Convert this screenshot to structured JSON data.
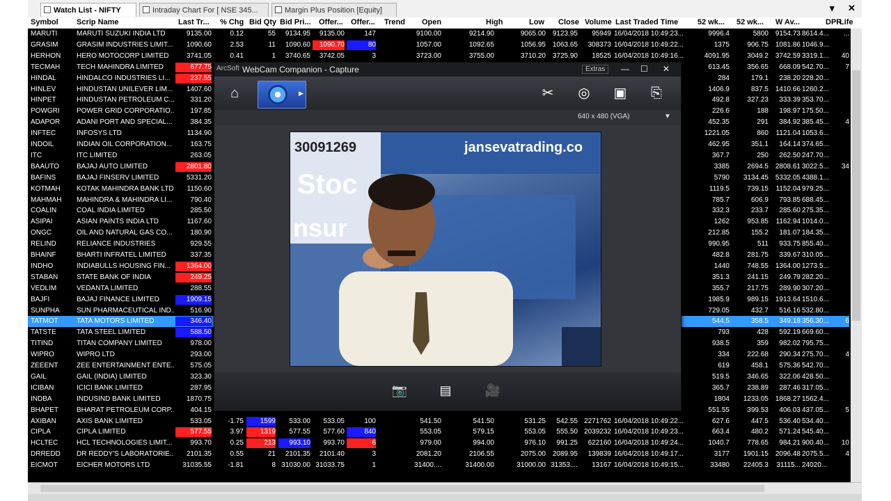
{
  "tabs": [
    {
      "label": "Watch List - NIFTY",
      "active": true
    },
    {
      "label": "Intraday Chart For [ NSE 345...",
      "active": false
    },
    {
      "label": "Margin Plus Position [Equity]",
      "active": false
    }
  ],
  "window_controls": {
    "dropdown": "▾",
    "close": "✕"
  },
  "columns": [
    "Symbol",
    "Scrip Name",
    "Last Tr...",
    "% Chg",
    "Bid Qty",
    "Bid Pri...",
    "Offer...",
    "Offer...",
    "Trend",
    "Open",
    "High",
    "Low",
    "Close",
    "Volume",
    "Last Traded Time",
    "52 wk...",
    "52 wk...",
    "W Av...",
    "DPR",
    "Life"
  ],
  "rows": [
    {
      "sym": "MARUTI",
      "name": "MARUTI SUZUKI INDIA LTD",
      "ltp": "9135.00",
      "chg": "0.12",
      "bq": "55",
      "bp": "9134.95",
      "op": "9135.00",
      "oq": "147",
      "open": "9100.00",
      "high": "9214.90",
      "low": "9065.00",
      "close": "9123.95",
      "vol": "95949",
      "ltt": "16/04/2018 10:49:23...",
      "h52": "9996.4",
      "l52": "5800",
      "wav": "9154.73",
      "dpr": "8614.4...",
      "life": "..."
    },
    {
      "sym": "GRASIM",
      "name": "GRASIM INDUSTRIES LIMIT...",
      "ltp": "1090.60",
      "chg": "2.53",
      "bq": "11",
      "bp": "1090.60",
      "op": "1090.70",
      "oq": "80",
      "open": "1057.00",
      "high": "1092.65",
      "low": "1056.95",
      "close": "1063.65",
      "vol": "308373",
      "ltt": "16/04/2018 10:49:22...",
      "h52": "1375",
      "l52": "906.75",
      "wav": "1081.86",
      "dpr": "1046.9...",
      "life": ""
    },
    {
      "sym": "HERHON",
      "name": "HERO MOTOCORP LIMITED",
      "ltp": "3741.05",
      "chg": "0.41",
      "bq": "1",
      "bp": "3740.65",
      "op": "3742.05",
      "oq": "3",
      "open": "3723.00",
      "high": "3755.00",
      "low": "3710.20",
      "close": "3725.90",
      "vol": "18525",
      "ltt": "16/04/2018 10:49:16...",
      "h52": "4091.95",
      "l52": "3049.2",
      "wav": "3742.59",
      "dpr": "3319.1...",
      "life": "40"
    },
    {
      "sym": "TECMAH",
      "name": "TECH MAHINDRA LIMITED",
      "ltp": "677.75",
      "h52": "613.45",
      "l52": "356.65",
      "wav": "668.09",
      "dpr": "542.70...",
      "life": "7"
    },
    {
      "sym": "HINDAL",
      "name": "HINDALCO INDUSTRIES LI...",
      "ltp": "237.55",
      "h52": "284",
      "l52": "179.1",
      "wav": "238.20",
      "dpr": "228.20...",
      "life": ""
    },
    {
      "sym": "HINLEV",
      "name": "HINDUSTAN UNILEVER LIM...",
      "ltp": "1407.60",
      "h52": "1406.9",
      "l52": "837.5",
      "wav": "1410.66",
      "dpr": "1260.2...",
      "life": ""
    },
    {
      "sym": "HINPET",
      "name": "HINDUSTAN PETROLEUM C...",
      "ltp": "331.20",
      "h52": "492.8",
      "l52": "327.23",
      "wav": "333.39",
      "dpr": "353.70...",
      "life": ""
    },
    {
      "sym": "POWGRI",
      "name": "POWER GRID CORPORATIO...",
      "ltp": "197.85",
      "h52": "226.6",
      "l52": "188",
      "wav": "198.97",
      "dpr": "175.50...",
      "life": ""
    },
    {
      "sym": "ADAPOR",
      "name": "ADANI PORT AND SPECIAL...",
      "ltp": "384.35",
      "h52": "452.35",
      "l52": "291",
      "wav": "384.92",
      "dpr": "385.45...",
      "life": "4"
    },
    {
      "sym": "INFTEC",
      "name": "INFOSYS LTD",
      "ltp": "1134.90",
      "h52": "1221.05",
      "l52": "860",
      "wav": "1121.04",
      "dpr": "1053.6...",
      "life": ""
    },
    {
      "sym": "INDOIL",
      "name": "INDIAN OIL CORPORATION...",
      "ltp": "163.75",
      "h52": "462.95",
      "l52": "351.1",
      "wav": "164.14",
      "dpr": "374.65...",
      "life": ""
    },
    {
      "sym": "ITC",
      "name": "ITC LIMITED",
      "ltp": "263.05",
      "h52": "367.7",
      "l52": "250",
      "wav": "262.50",
      "dpr": "247.70...",
      "life": ""
    },
    {
      "sym": "BAAUTO",
      "name": "BAJAJ AUTO LIMITED",
      "ltp": "2801.80",
      "h52": "3385",
      "l52": "2694.5",
      "wav": "2808.61",
      "dpr": "3022.5...",
      "life": "34"
    },
    {
      "sym": "BAFINS",
      "name": "BAJAJ FINSERV LIMITED",
      "ltp": "5331.20",
      "h52": "5790",
      "l52": "3134.45",
      "wav": "5332.05",
      "dpr": "4388.1...",
      "life": ""
    },
    {
      "sym": "KOTMAH",
      "name": "KOTAK MAHINDRA BANK LTD",
      "ltp": "1150.60",
      "h52": "1119.5",
      "l52": "739.15",
      "wav": "1152.04",
      "dpr": "979.25...",
      "life": ""
    },
    {
      "sym": "MAHMAH",
      "name": "MAHINDRA & MAHINDRA LI...",
      "ltp": "790.40",
      "h52": "785.7",
      "l52": "606.9",
      "wav": "793.85",
      "dpr": "688.45...",
      "life": ""
    },
    {
      "sym": "COALIN",
      "name": "COAL INDIA LIMITED",
      "ltp": "285.50",
      "h52": "332.3",
      "l52": "233.7",
      "wav": "285.60",
      "dpr": "275.35...",
      "life": ""
    },
    {
      "sym": "ASIPAI",
      "name": "ASIAN PAINTS INDIA LTD",
      "ltp": "1167.60",
      "h52": "1262",
      "l52": "953.85",
      "wav": "1162.94",
      "dpr": "1014.0...",
      "life": ""
    },
    {
      "sym": "ONGC",
      "name": "OIL AND NATURAL GAS CO...",
      "ltp": "180.90",
      "h52": "212.85",
      "l52": "155.2",
      "wav": "181.07",
      "dpr": "184.35...",
      "life": ""
    },
    {
      "sym": "RELIND",
      "name": "RELIANCE INDUSTRIES",
      "ltp": "929.55",
      "h52": "990.95",
      "l52": "511",
      "wav": "933.75",
      "dpr": "855.40...",
      "life": ""
    },
    {
      "sym": "BHAINF",
      "name": "BHARTI INFRATEL LIMITED",
      "ltp": "337.35",
      "h52": "482.8",
      "l52": "281.75",
      "wav": "339.67",
      "dpr": "310.05...",
      "life": ""
    },
    {
      "sym": "INDHO",
      "name": "INDIABULLS HOUSING FIN...",
      "ltp": "1364.00",
      "h52": "1440",
      "l52": "748.55",
      "wav": "1364.00",
      "dpr": "1273.5...",
      "life": ""
    },
    {
      "sym": "STABAN",
      "name": "STATE BANK OF INDIA",
      "ltp": "249.25",
      "h52": "351.3",
      "l52": "241.15",
      "wav": "249.79",
      "dpr": "282.20...",
      "life": ""
    },
    {
      "sym": "VEDLIM",
      "name": "VEDANTA LIMITED",
      "ltp": "288.55",
      "h52": "355.7",
      "l52": "217.75",
      "wav": "289.90",
      "dpr": "307.20...",
      "life": ""
    },
    {
      "sym": "BAJFI",
      "name": "BAJAJ FINANCE LIMITED",
      "ltp": "1909.15",
      "h52": "1985.9",
      "l52": "989.15",
      "wav": "1913.64",
      "dpr": "1510.6...",
      "life": ""
    },
    {
      "sym": "SUNPHA",
      "name": "SUN PHARMACEUTICAL IND...",
      "ltp": "516.90",
      "h52": "729.05",
      "l52": "432.7",
      "wav": "516.16",
      "dpr": "532.80...",
      "life": ""
    },
    {
      "sym": "TATMOT",
      "name": "TATA MOTORS LIMITED",
      "ltp": "346.40",
      "h52": "544.5",
      "l52": "358.5",
      "wav": "349.18",
      "dpr": "356.30...",
      "life": "6"
    },
    {
      "sym": "TATSTE",
      "name": "TATA STEEL LIMITED",
      "ltp": "588.50",
      "h52": "793",
      "l52": "428",
      "wav": "592.19",
      "dpr": "669.60...",
      "life": ""
    },
    {
      "sym": "TITIND",
      "name": "TITAN COMPANY LIMITED",
      "ltp": "978.00",
      "h52": "938.5",
      "l52": "359",
      "wav": "982.02",
      "dpr": "795.75...",
      "life": ""
    },
    {
      "sym": "WIPRO",
      "name": "WIPRO LTD",
      "ltp": "293.00",
      "h52": "334",
      "l52": "222.68",
      "wav": "290.34",
      "dpr": "275.70...",
      "life": "4"
    },
    {
      "sym": "ZEEENT",
      "name": "ZEE ENTERTAINMENT ENTE...",
      "ltp": "575.05",
      "h52": "619",
      "l52": "458.1",
      "wav": "575.36",
      "dpr": "542.70...",
      "life": ""
    },
    {
      "sym": "GAIL",
      "name": "GAIL (INDIA) LIMITED",
      "ltp": "323.30",
      "h52": "519.5",
      "l52": "346.65",
      "wav": "322.06",
      "dpr": "428.50...",
      "life": ""
    },
    {
      "sym": "ICIBAN",
      "name": "ICICI BANK LIMITED",
      "ltp": "287.95",
      "h52": "365.7",
      "l52": "238.89",
      "wav": "287.46",
      "dpr": "317.05...",
      "life": ""
    },
    {
      "sym": "INDBA",
      "name": "INDUSIND BANK LIMITED",
      "ltp": "1870.75",
      "h52": "1804",
      "l52": "1233.05",
      "wav": "1868.27",
      "dpr": "1562.4...",
      "life": ""
    },
    {
      "sym": "BHAPET",
      "name": "BHARAT PETROLEUM CORP...",
      "ltp": "404.15",
      "h52": "551.55",
      "l52": "399.53",
      "wav": "406.03",
      "dpr": "437.05...",
      "life": "5"
    },
    {
      "sym": "AXIBAN",
      "name": "AXIS BANK LIMITED",
      "ltp": "533.05",
      "chg": "-1.75",
      "bq": "1599",
      "bp": "533.00",
      "op": "533.05",
      "oq": "100",
      "open": "541.50",
      "high": "541.50",
      "low": "531.25",
      "close": "542.55",
      "vol": "2271762",
      "ltt": "16/04/2018 10:49:22...",
      "h52": "627.6",
      "l52": "447.5",
      "wav": "536.40",
      "dpr": "534.40...",
      "life": ""
    },
    {
      "sym": "CIPLA",
      "name": "CIPLA LIMITED",
      "ltp": "577.55",
      "chg": "3.97",
      "bq": "1319",
      "bp": "577.55",
      "op": "577.60",
      "oq": "840",
      "open": "553.05",
      "high": "579.15",
      "low": "553.05",
      "close": "555.50",
      "vol": "2039232",
      "ltt": "16/04/2018 10:49:23...",
      "h52": "663.4",
      "l52": "480.2",
      "wav": "571.24",
      "dpr": "545.40...",
      "life": ""
    },
    {
      "sym": "HCLTEC",
      "name": "HCL TECHNOLOGIES LIMIT...",
      "ltp": "993.70",
      "chg": "0.25",
      "bq": "213",
      "bp": "993.10",
      "op": "993.70",
      "oq": "6",
      "open": "979.00",
      "high": "994.00",
      "low": "976.10",
      "close": "991.25",
      "vol": "622160",
      "ltt": "16/04/2018 10:49:24...",
      "h52": "1040.7",
      "l52": "778.65",
      "wav": "984.21",
      "dpr": "900.40...",
      "life": "10"
    },
    {
      "sym": "DRREDD",
      "name": "DR REDDY'S LABORATORIE...",
      "ltp": "2101.35",
      "chg": "0.55",
      "bq": "21",
      "bp": "2101.35",
      "op": "2101.40",
      "oq": "3",
      "open": "2081.20",
      "high": "2106.55",
      "low": "2075.00",
      "close": "2089.95",
      "vol": "139839",
      "ltt": "16/04/2018 10:49:17...",
      "h52": "3177",
      "l52": "1901.15",
      "wav": "2096.48",
      "dpr": "2075.5...",
      "life": "4"
    },
    {
      "sym": "EICMOT",
      "name": "EICHER MOTORS LTD",
      "ltp": "31035.55",
      "chg": "-1.81",
      "bq": "8",
      "bp": "31030.00",
      "op": "31033.75",
      "oq": "1",
      "open": "31400....",
      "high": "31400.00",
      "low": "31000.00",
      "close": "31353....",
      "vol": "13167",
      "ltt": "16/04/2018 10:49:15...",
      "h52": "33480",
      "l52": "22405.3",
      "wav": "31115...",
      "dpr": "24020...",
      "life": ""
    }
  ],
  "row_highlights": {
    "ltp_red": [
      "TECMAH",
      "HINDAL",
      "BAAUTO",
      "INDHO",
      "STABAN",
      "CIPLA"
    ],
    "ltp_blue": [
      "BAJFI",
      "TATSTE",
      "TATMOT"
    ],
    "selected": "TATMOT",
    "bq_red": [
      "CIPLA",
      "HCLTEC"
    ],
    "bq_blue": [
      "AXIBAN"
    ],
    "bp_blue": [
      "HCLTEC"
    ],
    "op_red": [
      "GRASIM"
    ],
    "oq_blue": [
      "GRASIM",
      "CIPLA"
    ],
    "oq_red": [
      "HCLTEC"
    ]
  },
  "colors": {
    "red": "#ff2020",
    "blue": "#1a1aff",
    "selected": "#3399ff",
    "grid_bg": "#000000"
  },
  "webcam": {
    "brand": "ArcSoft",
    "title": "WebCam Companion - Capture",
    "extras": "Extras",
    "resolution": "640 x 480 (VGA)",
    "toolbar_icons": [
      "home-icon",
      "capture-mode-icon",
      "tools-icon",
      "webcam-settings-icon",
      "monitor-icon",
      "export-icon"
    ],
    "bottom_icons": [
      "camera-icon",
      "gallery-icon",
      "video-icon"
    ],
    "video_overlay_texts": [
      "30091269",
      "jansevatrading.co",
      "Stoc",
      "nsur"
    ]
  }
}
